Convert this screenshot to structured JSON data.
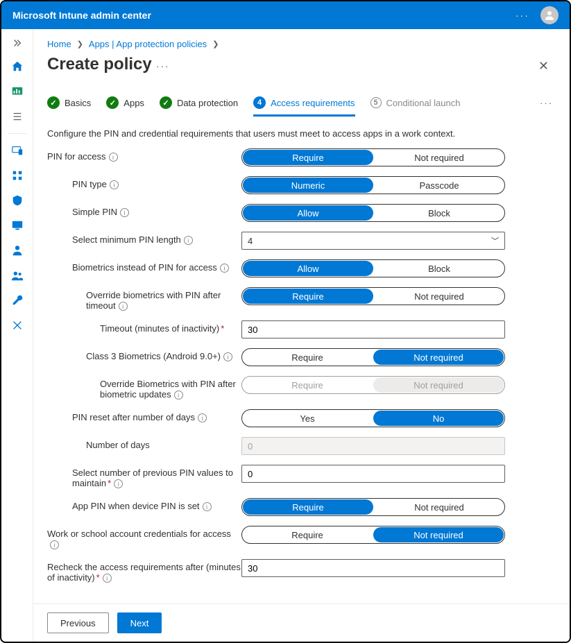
{
  "app": {
    "title": "Microsoft Intune admin center"
  },
  "breadcrumbs": {
    "home": "Home",
    "apps": "Apps | App protection policies"
  },
  "page": {
    "title": "Create policy",
    "intro": "Configure the PIN and credential requirements that users must meet to access apps in a work context."
  },
  "steps": {
    "s1": "Basics",
    "s2": "Apps",
    "s3": "Data protection",
    "s4_num": "4",
    "s4": "Access requirements",
    "s5_num": "5",
    "s5": "Conditional launch"
  },
  "labels": {
    "pin_for_access": "PIN for access",
    "pin_type": "PIN type",
    "simple_pin": "Simple PIN",
    "min_pin_length": "Select minimum PIN length",
    "biometrics_instead": "Biometrics instead of PIN for access",
    "override_bio_timeout": "Override biometrics with PIN after timeout",
    "timeout_label": "Timeout (minutes of inactivity)",
    "class3_bio": "Class 3 Biometrics (Android 9.0+)",
    "override_bio_updates": "Override Biometrics with PIN after biometric updates",
    "pin_reset_days_label": "PIN reset after number of days",
    "number_of_days": "Number of days",
    "prev_pin_values": "Select number of previous PIN values to maintain",
    "app_pin_when_device_pin": "App PIN when device PIN is set",
    "work_account_creds": "Work or school account credentials for access",
    "recheck_label": "Recheck the access requirements after (minutes of inactivity)"
  },
  "options": {
    "require": "Require",
    "not_required": "Not required",
    "numeric": "Numeric",
    "passcode": "Passcode",
    "allow": "Allow",
    "block": "Block",
    "yes": "Yes",
    "no": "No"
  },
  "values": {
    "min_pin_length": "4",
    "timeout_minutes": "30",
    "number_of_days": "0",
    "prev_pin_values": "0",
    "recheck_minutes": "30"
  },
  "footer": {
    "previous": "Previous",
    "next": "Next"
  },
  "nav": {
    "items": [
      "home",
      "dashboard",
      "all-services",
      "divider",
      "devices",
      "apps",
      "endpoint-security",
      "reports",
      "users",
      "groups",
      "tenant-admin",
      "troubleshooting"
    ]
  }
}
